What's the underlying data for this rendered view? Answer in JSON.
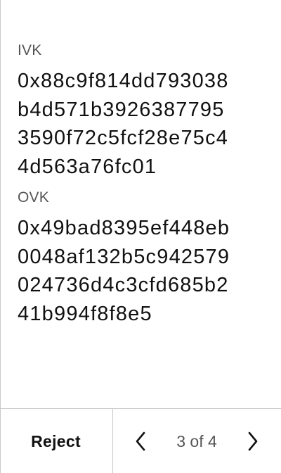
{
  "fields": [
    {
      "label": "IVK",
      "value_lines": [
        "0x88c9f814dd793038",
        "b4d571b3926387795",
        "3590f72c5fcf28e75c4",
        "4d563a76fc01"
      ]
    },
    {
      "label": "OVK",
      "value_lines": [
        "0x49bad8395ef448eb",
        "0048af132b5c942579",
        "024736d4c3cfd685b2",
        "41b994f8f8e5"
      ]
    }
  ],
  "footer": {
    "reject_label": "Reject",
    "page_indicator": "3 of 4",
    "prev_icon": "chevron-left-icon",
    "next_icon": "chevron-right-icon"
  }
}
